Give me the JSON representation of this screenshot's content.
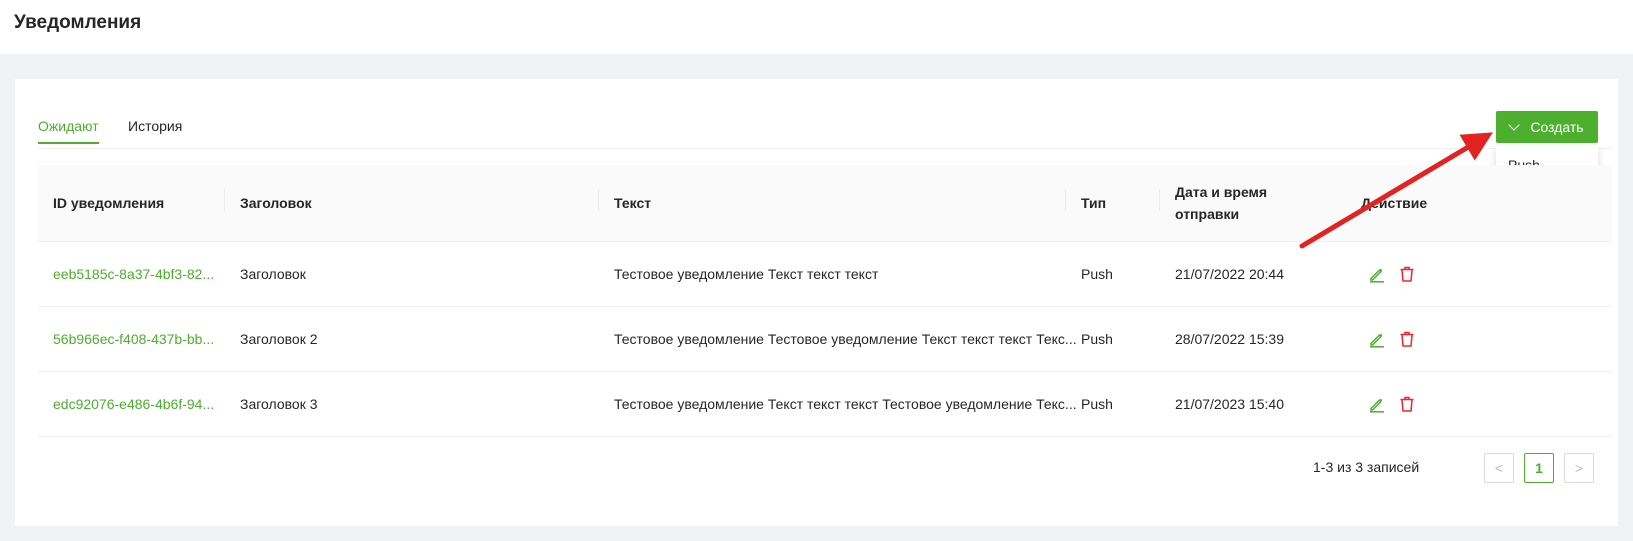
{
  "page": {
    "title": "Уведомления"
  },
  "tabs": [
    {
      "label": "Ожидают",
      "active": true
    },
    {
      "label": "История",
      "active": false
    }
  ],
  "create_button": {
    "label": "Создать",
    "icon": "chevron-down-icon"
  },
  "dropdown": {
    "items": [
      "Push"
    ]
  },
  "table": {
    "columns": [
      "ID уведомления",
      "Заголовок",
      "Текст",
      "Тип",
      "Дата и время отправки",
      "Действие"
    ],
    "date_header_line1": "Дата и время",
    "date_header_line2": "отправки",
    "rows": [
      {
        "id": "eeb5185c-8a37-4bf3-82...",
        "title": "Заголовок",
        "text": "Тестовое уведомление Текст текст текст",
        "type": "Push",
        "datetime": "21/07/2022 20:44"
      },
      {
        "id": "56b966ec-f408-437b-bb...",
        "title": "Заголовок 2",
        "text": "Тестовое уведомление Тестовое уведомление Текст текст текст Текс...",
        "type": "Push",
        "datetime": "28/07/2022 15:39"
      },
      {
        "id": "edc92076-e486-4b6f-94...",
        "title": "Заголовок 3",
        "text": "Тестовое уведомление Текст текст текст Тестовое уведомление Текс...",
        "type": "Push",
        "datetime": "21/07/2023 15:40"
      }
    ],
    "action_icons": [
      "edit-icon",
      "trash-icon"
    ]
  },
  "pagination": {
    "total_text": "1-3 из 3 записей",
    "current_page": "1",
    "prev": "<",
    "next": ">"
  },
  "colors": {
    "accent": "#4caf2e",
    "danger": "#f5222d",
    "arrow": "#e32222"
  }
}
